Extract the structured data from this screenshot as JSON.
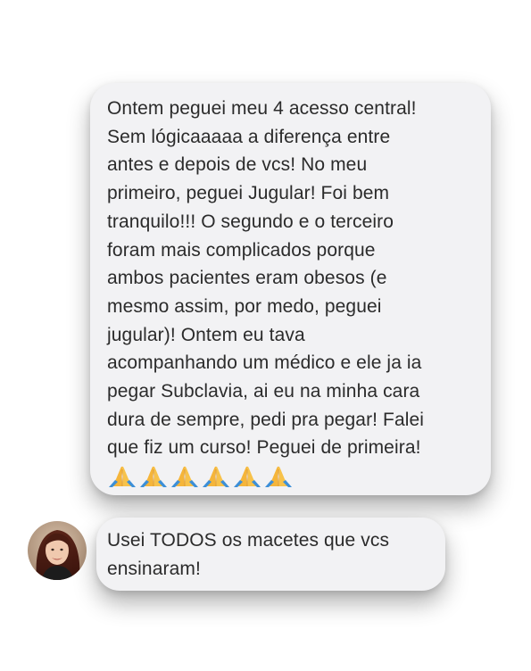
{
  "conversation": {
    "first_message": {
      "lines": [
        "Ontem peguei meu 4 acesso central!",
        "Sem lógicaaaaa a diferença entre",
        "antes e depois de vcs! No meu",
        "primeiro, peguei Jugular! Foi bem",
        "tranquilo!!! O segundo e o terceiro",
        "foram mais complicados porque",
        "ambos pacientes eram obesos (e",
        "mesmo assim, por medo, peguei",
        "jugular)! Ontem eu tava",
        "acompanhando um médico e ele ja ia",
        "pegar Subclavia, ai eu na minha cara",
        "dura de sempre, pedi pra pegar! Falei",
        "que fiz um curso! Peguei de primeira!"
      ],
      "emoji_icon": "folded-hands-emoji",
      "emoji_count": 6
    },
    "second_message": {
      "lines": [
        "Usei TODOS os macetes que vcs",
        "ensinaram!"
      ]
    },
    "avatar_icon": "user-avatar-photo"
  },
  "colors": {
    "bubble_background": "#f2f2f4",
    "text": "#2b2b2b",
    "page_background": "#ffffff"
  }
}
